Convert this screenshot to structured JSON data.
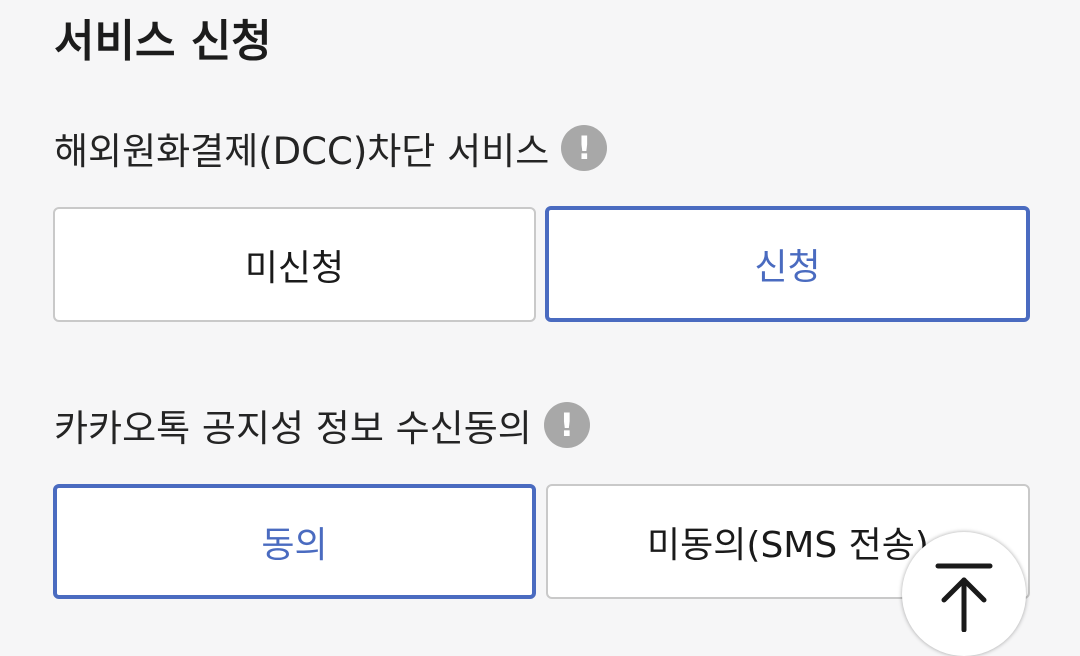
{
  "section": {
    "title": "서비스 신청"
  },
  "dcc": {
    "label": "해외원화결제(DCC)차단 서비스",
    "info_icon": "!",
    "options": [
      "미신청",
      "신청"
    ],
    "selected": "신청"
  },
  "kakao": {
    "label": "카카오톡 공지성 정보 수신동의",
    "info_icon": "!",
    "options": [
      "동의",
      "미동의(SMS 전송)"
    ],
    "selected": "동의"
  },
  "scroll_top": {
    "icon": "arrow-up-to-line-icon"
  },
  "colors": {
    "accent": "#4a6bc0",
    "info_icon_bg": "#a8a8a8",
    "unselected_border": "#c9c9c9",
    "background": "#f6f6f7"
  }
}
